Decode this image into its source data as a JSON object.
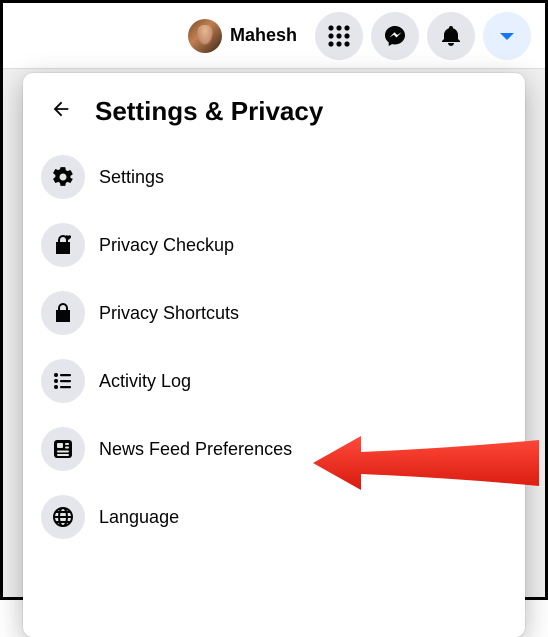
{
  "profile": {
    "name": "Mahesh"
  },
  "panel": {
    "title": "Settings & Privacy",
    "items": [
      {
        "label": "Settings",
        "icon": "gear-icon"
      },
      {
        "label": "Privacy Checkup",
        "icon": "lock-heart-icon"
      },
      {
        "label": "Privacy Shortcuts",
        "icon": "lock-icon"
      },
      {
        "label": "Activity Log",
        "icon": "list-icon"
      },
      {
        "label": "News Feed Preferences",
        "icon": "feed-icon"
      },
      {
        "label": "Language",
        "icon": "globe-icon"
      }
    ]
  }
}
